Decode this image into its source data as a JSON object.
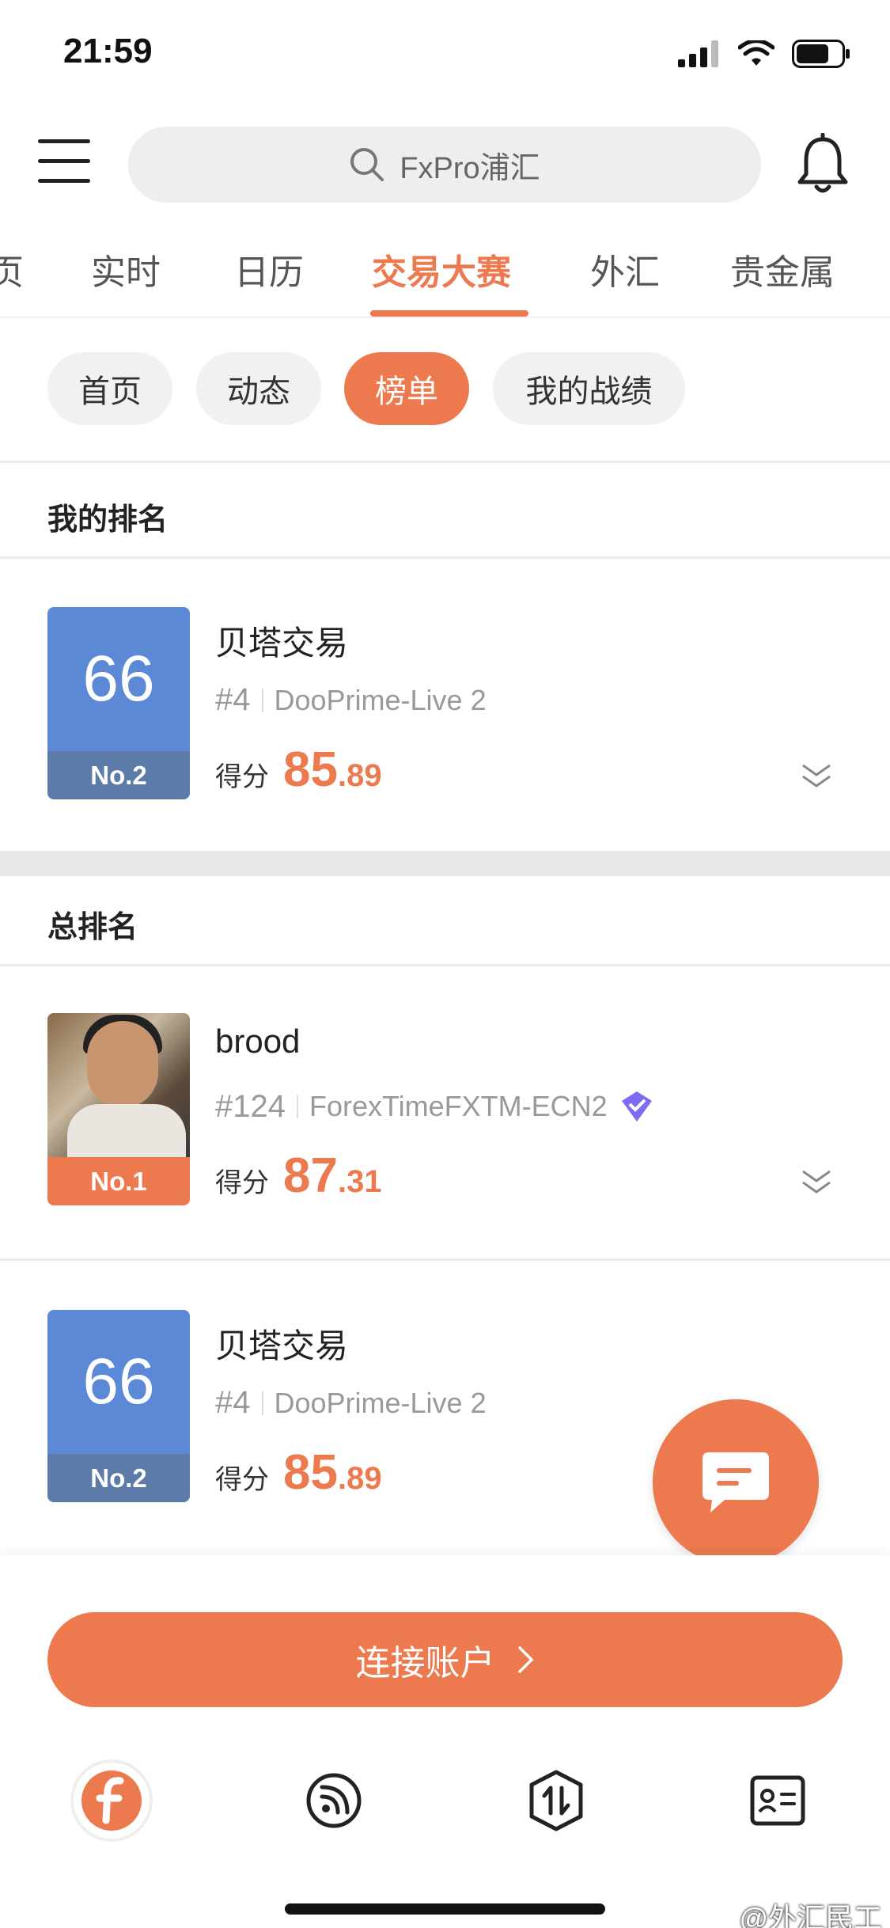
{
  "status_bar": {
    "time": "21:59"
  },
  "header": {
    "search_placeholder": "FxPro浦汇",
    "icons": {
      "menu": "hamburger-menu-icon",
      "search": "search-icon",
      "bell": "bell-icon"
    }
  },
  "tabs": [
    {
      "label": "页"
    },
    {
      "label": "实时"
    },
    {
      "label": "日历"
    },
    {
      "label": "交易大赛",
      "active": true
    },
    {
      "label": "外汇"
    },
    {
      "label": "贵金属"
    }
  ],
  "sub_tabs": [
    {
      "label": "首页"
    },
    {
      "label": "动态"
    },
    {
      "label": "榜单",
      "active": true
    },
    {
      "label": "我的战绩"
    }
  ],
  "my_ranking": {
    "title": "我的排名",
    "entry": {
      "score_badge": "66",
      "rank_label": "No.2",
      "name": "贝塔交易",
      "rank_no": "#4",
      "account": "DooPrime-Live 2",
      "score_label": "得分",
      "score_int": "85",
      "score_dec": ".89"
    }
  },
  "overall_ranking": {
    "title": "总排名",
    "entries": [
      {
        "avatar": "user-photo",
        "rank_label": "No.1",
        "name": "brood",
        "rank_no": "#124",
        "account": "ForexTimeFXTM-ECN2",
        "verified_icon": "diamond-verified-icon",
        "score_label": "得分",
        "score_int": "87",
        "score_dec": ".31"
      },
      {
        "score_badge": "66",
        "rank_label": "No.2",
        "name": "贝塔交易",
        "rank_no": "#4",
        "account": "DooPrime-Live 2",
        "score_label": "得分",
        "score_int": "85",
        "score_dec": ".89"
      }
    ]
  },
  "fab_icon": "chat-bubble-icon",
  "connect_button": {
    "label": "连接账户"
  },
  "bottom_nav": [
    {
      "icon": "fx-logo-icon"
    },
    {
      "icon": "feed-icon"
    },
    {
      "icon": "trade-icon"
    },
    {
      "icon": "profile-card-icon"
    }
  ],
  "watermark": "@外汇民工",
  "colors": {
    "accent": "#ec7a4e",
    "badge_blue": "#5b89d6",
    "badge_label": "#5c7ba8"
  }
}
